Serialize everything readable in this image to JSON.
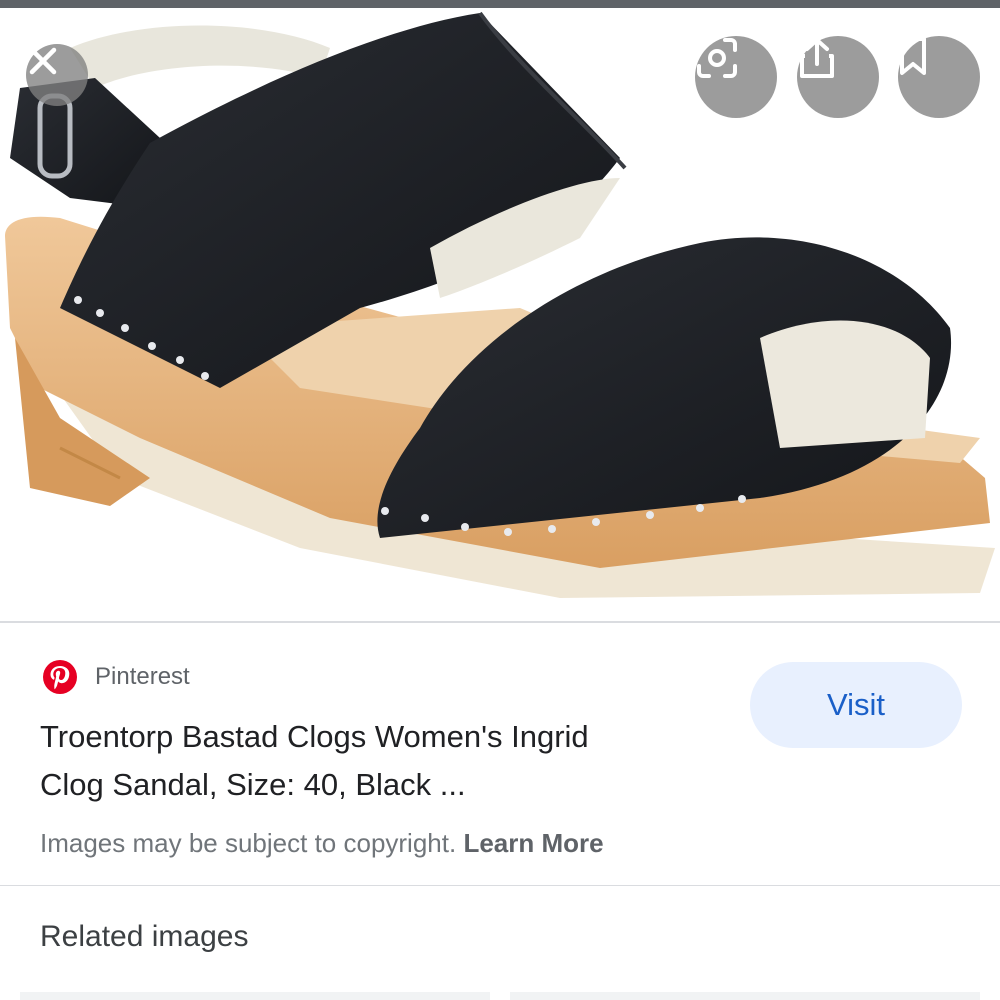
{
  "photo": {
    "alt": "Troentorp Bastad Clogs Women's Ingrid Clog Sandal, Size: 40, Black ...",
    "leather_color": "#1d1f24",
    "wood_color": "#e3b47e",
    "sole_color": "#efe6d4"
  },
  "overlay": {
    "close_icon": "close-icon",
    "lens_icon": "lens-icon",
    "share_icon": "share-icon",
    "save_icon": "bookmark-icon"
  },
  "source": {
    "name": "Pinterest",
    "icon": "pinterest-icon",
    "brand_color": "#e60023"
  },
  "visit_label": "Visit",
  "title_line1": "Troentorp Bastad Clogs Women's Ingrid",
  "title_line2": "Clog Sandal, Size: 40, Black ...",
  "copyright_text": "Images may be subject to copyright.",
  "learn_more_label": "Learn More",
  "related_heading": "Related images"
}
